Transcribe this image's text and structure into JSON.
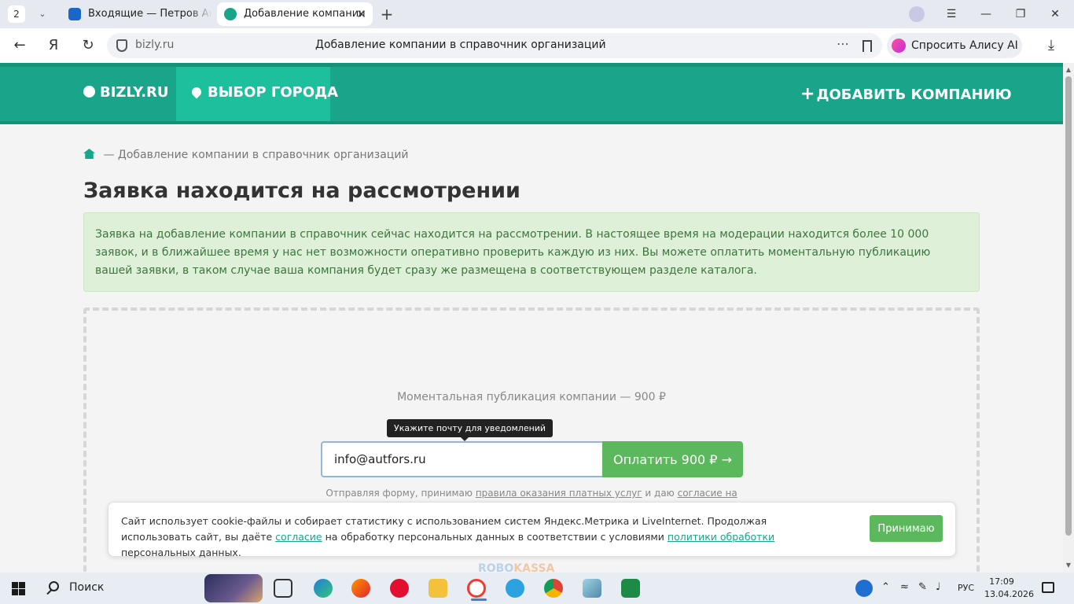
{
  "browser": {
    "tab_count": "2",
    "tabs": [
      {
        "title": "Входящие — Петров Анто"
      },
      {
        "title": "Добавление компании"
      }
    ],
    "address": {
      "domain": "bizly.ru",
      "page_title": "Добавление компании в справочник организаций"
    },
    "alice_label": "Спросить Алису AI"
  },
  "site": {
    "brand": "BIZLY.RU",
    "city_select": "ВЫБОР ГОРОДА",
    "add_company": "ДОБАВИТЬ КОМПАНИЮ",
    "accent_color": "#18a58a"
  },
  "breadcrumb": {
    "separator": "—",
    "current": "Добавление компании в справочник организаций"
  },
  "page": {
    "title": "Заявка находится на рассмотрении",
    "notice": "Заявка на добавление компании в справочник сейчас находится на рассмотрении. В настоящее время на модерации находится более 10 000 заявок, и в ближайшее время у нас нет возможности оперативно проверить каждую из них. Вы можете оплатить моментальную публикацию вашей заявки, в таком случае ваша компания будет сразу же размещена в соответствующем разделе каталога."
  },
  "payment": {
    "caption": "Моментальная публикация компании — 900 ₽",
    "tooltip": "Укажите почту для уведомлений",
    "email_value": "info@autfors.ru",
    "pay_button": "Оплатить 900 ₽ →",
    "terms_prefix": "Отправляя форму, принимаю",
    "terms_link": "правила оказания платных услуг",
    "terms_middle": "и даю",
    "consent_link": "согласие на",
    "provider_a": "ROBO",
    "provider_b": "KASSA"
  },
  "cookie": {
    "text_1": "Сайт использует cookie-файлы и собирает статистику с использованием систем Яндекс.Метрика и LiveInternet. Продолжая использовать сайт, вы даёте",
    "link_consent": "согласие",
    "text_2": "на обработку персональных данных в соответствии с условиями",
    "link_policy": "политики обработки",
    "text_3": "персональных данных.",
    "accept": "Принимаю"
  },
  "taskbar": {
    "search_label": "Поиск",
    "language": "РУС",
    "time": "17:09",
    "date": "13.04.2026"
  }
}
